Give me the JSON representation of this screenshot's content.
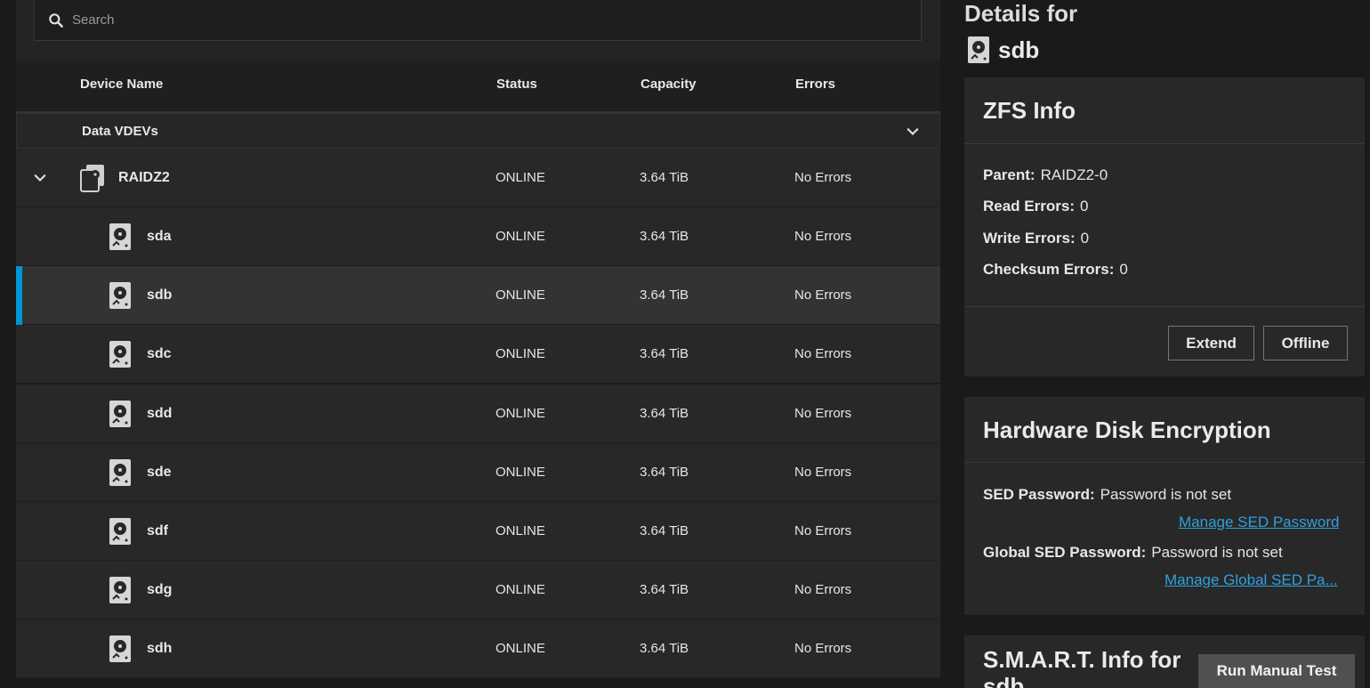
{
  "search": {
    "placeholder": "Search"
  },
  "table": {
    "headers": {
      "device": "Device Name",
      "status": "Status",
      "capacity": "Capacity",
      "errors": "Errors"
    },
    "group_label": "Data VDEVs",
    "vdev": {
      "name": "RAIDZ2",
      "status": "ONLINE",
      "capacity": "3.64 TiB",
      "errors": "No Errors"
    },
    "disks": [
      {
        "name": "sda",
        "status": "ONLINE",
        "capacity": "3.64 TiB",
        "errors": "No Errors"
      },
      {
        "name": "sdb",
        "status": "ONLINE",
        "capacity": "3.64 TiB",
        "errors": "No Errors",
        "selected": true
      },
      {
        "name": "sdc",
        "status": "ONLINE",
        "capacity": "3.64 TiB",
        "errors": "No Errors"
      },
      {
        "name": "sdd",
        "status": "ONLINE",
        "capacity": "3.64 TiB",
        "errors": "No Errors"
      },
      {
        "name": "sde",
        "status": "ONLINE",
        "capacity": "3.64 TiB",
        "errors": "No Errors"
      },
      {
        "name": "sdf",
        "status": "ONLINE",
        "capacity": "3.64 TiB",
        "errors": "No Errors"
      },
      {
        "name": "sdg",
        "status": "ONLINE",
        "capacity": "3.64 TiB",
        "errors": "No Errors"
      },
      {
        "name": "sdh",
        "status": "ONLINE",
        "capacity": "3.64 TiB",
        "errors": "No Errors"
      }
    ]
  },
  "details": {
    "title": "Details for",
    "device": "sdb",
    "zfs": {
      "title": "ZFS Info",
      "parent_label": "Parent:",
      "parent_value": "RAIDZ2-0",
      "read_label": "Read Errors:",
      "read_value": "0",
      "write_label": "Write Errors:",
      "write_value": "0",
      "checksum_label": "Checksum Errors:",
      "checksum_value": "0",
      "extend_label": "Extend",
      "offline_label": "Offline"
    },
    "encryption": {
      "title": "Hardware Disk Encryption",
      "sed_label": "SED Password:",
      "sed_value": "Password is not set",
      "sed_link": "Manage SED Password",
      "global_label": "Global SED Password:",
      "global_value": "Password is not set",
      "global_link": "Manage Global SED Pa..."
    },
    "smart": {
      "title": "S.M.A.R.T. Info for",
      "title_cont": "sdb",
      "run_label": "Run Manual Test"
    }
  },
  "colors": {
    "accent": "#0095d5",
    "link": "#2ea0de"
  },
  "icons": [
    "search-icon",
    "chevron-down-icon",
    "disk-icon",
    "pool-icon"
  ]
}
